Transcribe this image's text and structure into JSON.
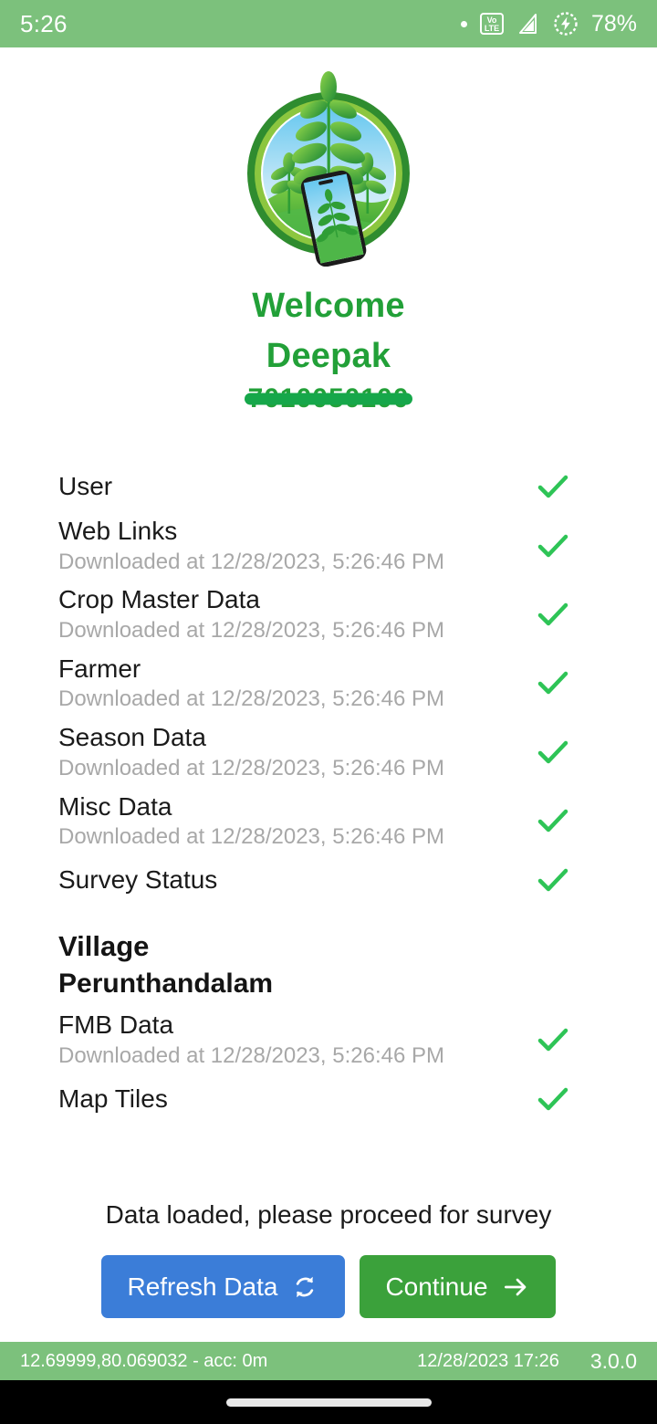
{
  "status_bar": {
    "time": "5:26",
    "network_label": "VoLTE",
    "battery_percent": "78%",
    "icons": [
      "dot-icon",
      "volte-icon",
      "signal-icon",
      "battery-charging-icon"
    ]
  },
  "logo": {
    "name": "crop-survey-app-logo"
  },
  "header": {
    "greeting": "Welcome",
    "user_name": "Deepak",
    "phone_number": "7010050100",
    "phone_number_redacted": true,
    "accent_color": "#22a038"
  },
  "sync_items": [
    {
      "title": "User",
      "subtitle": "",
      "status": "check"
    },
    {
      "title": "Web Links",
      "subtitle": "Downloaded at 12/28/2023, 5:26:46 PM",
      "status": "check"
    },
    {
      "title": "Crop Master Data",
      "subtitle": "Downloaded at 12/28/2023, 5:26:46 PM",
      "status": "check"
    },
    {
      "title": "Farmer",
      "subtitle": "Downloaded at 12/28/2023, 5:26:46 PM",
      "status": "check"
    },
    {
      "title": "Season Data",
      "subtitle": "Downloaded at 12/28/2023, 5:26:46 PM",
      "status": "check"
    },
    {
      "title": "Misc Data",
      "subtitle": "Downloaded at 12/28/2023, 5:26:46 PM",
      "status": "check"
    },
    {
      "title": "Survey Status",
      "subtitle": "",
      "status": "check"
    }
  ],
  "village": {
    "label": "Village",
    "name": "Perunthandalam"
  },
  "village_items": [
    {
      "title": "FMB Data",
      "subtitle": "Downloaded at 12/28/2023, 5:26:46 PM",
      "status": "check"
    },
    {
      "title": "Map Tiles",
      "subtitle": "",
      "status": "check"
    }
  ],
  "status_message": "Data loaded, please proceed for survey",
  "actions": {
    "refresh_label": "Refresh Data",
    "refresh_icon": "refresh-icon",
    "refresh_color": "#3b7dd8",
    "continue_label": "Continue",
    "continue_icon": "arrow-right-icon",
    "continue_color": "#3ba13b"
  },
  "info_bar": {
    "location": "12.69999,80.069032 - acc: 0m",
    "datetime": "12/28/2023 17:26",
    "version": "3.0.0",
    "background": "#7cc17c"
  }
}
